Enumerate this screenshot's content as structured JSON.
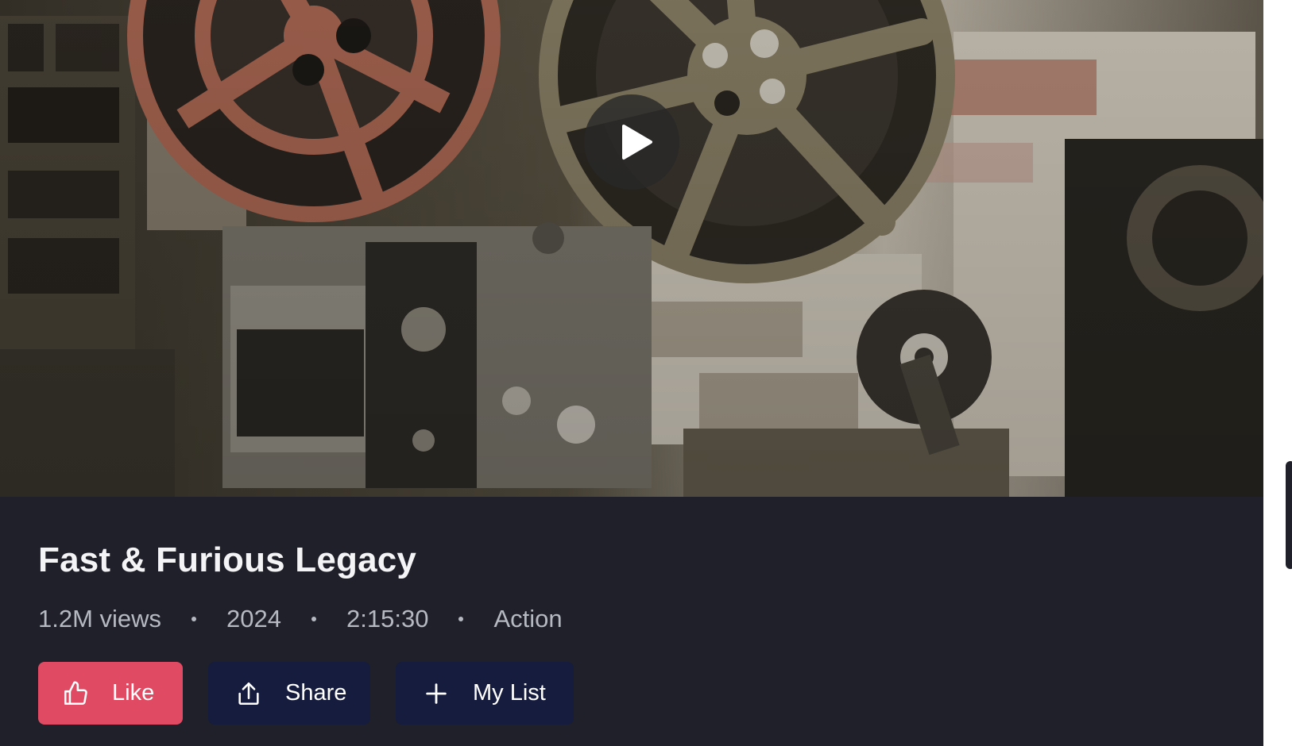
{
  "video": {
    "title": "Fast & Furious Legacy",
    "views": "1.2M views",
    "year": "2024",
    "duration": "2:15:30",
    "genre": "Action"
  },
  "hero": {
    "thumbnail": "vintage-film-projectors-and-reels",
    "play_icon": "play-icon"
  },
  "actions": {
    "like_label": "Like",
    "like_icon": "thumbs-up-icon",
    "share_label": "Share",
    "share_icon": "share-icon",
    "list_label": "My List",
    "list_icon": "plus-icon"
  },
  "colors": {
    "background": "#1f2029",
    "like_button": "#e04a62",
    "secondary_button": "#151c3d",
    "title_text": "#f4f4f6",
    "meta_text": "#b6b8c2"
  }
}
